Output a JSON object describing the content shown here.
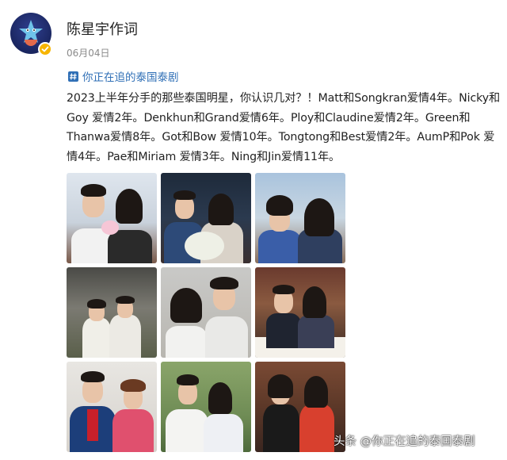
{
  "user": {
    "name": "陈星宇作词",
    "date": "06月04日"
  },
  "topic": {
    "label": "你正在追的泰国泰剧"
  },
  "post": {
    "text": "2023上半年分手的那些泰国明星，你认识几对？！Matt和Songkran爱情4年。Nicky和Goy 爱情2年。Denkhun和Grand爱情6年。Ploy和Claudine爱情2年。Green和Thanwa爱情8年。Got和Bow 爱情10年。Tongtong和Best爱情2年。AumP和Pok 爱情4年。Pae和Miriam 爱情3年。Ning和Jin爱情11年。"
  },
  "photos": [
    {
      "name": "photo-1"
    },
    {
      "name": "photo-2"
    },
    {
      "name": "photo-3"
    },
    {
      "name": "photo-4"
    },
    {
      "name": "photo-5"
    },
    {
      "name": "photo-6"
    },
    {
      "name": "photo-7"
    },
    {
      "name": "photo-8"
    },
    {
      "name": "photo-9"
    }
  ],
  "watermark": {
    "text": "头条 @你正在追的泰国泰剧"
  },
  "colors": {
    "topic_link": "#2f6fb6",
    "verified_badge": "#f7b500",
    "date_gray": "#8a8a8a"
  }
}
